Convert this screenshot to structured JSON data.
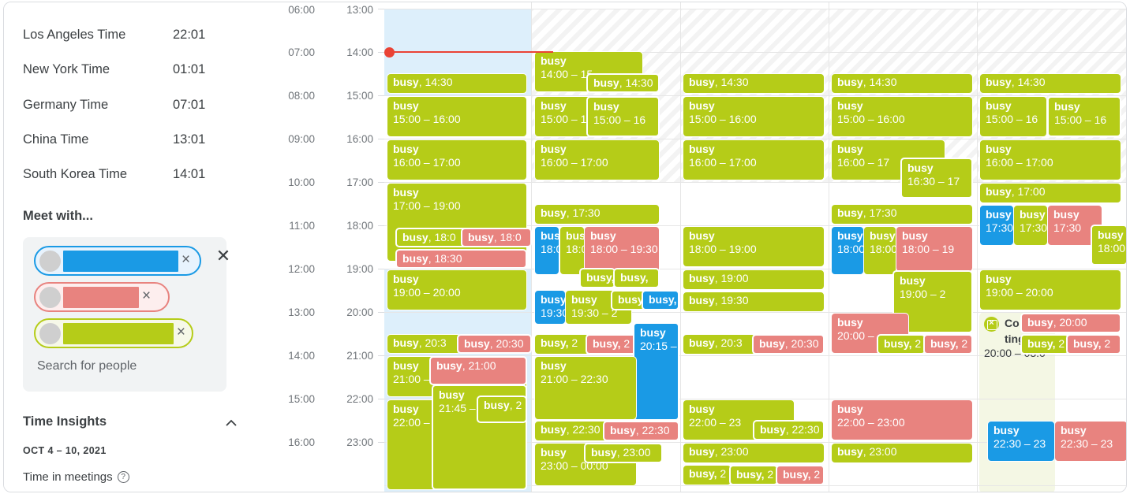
{
  "sidebar": {
    "timezones": [
      {
        "name": "Los Angeles Time",
        "time": "22:01",
        "icon": "moon-icon"
      },
      {
        "name": "New York Time",
        "time": "01:01",
        "icon": "moon-icon"
      },
      {
        "name": "Germany Time",
        "time": "07:01",
        "icon": "sun-icon"
      },
      {
        "name": "China Time",
        "time": "13:01",
        "icon": "sun-icon"
      },
      {
        "name": "South Korea Time",
        "time": "14:01",
        "icon": "sun-icon"
      }
    ],
    "meet_with": {
      "title": "Meet with...",
      "people": [
        {
          "color": "#1a9ae5",
          "remove_label": "×"
        },
        {
          "color": "#e8837f",
          "remove_label": "×"
        },
        {
          "color": "#b5cc18",
          "remove_label": "×"
        }
      ],
      "close_label": "✕",
      "search_placeholder": "Search for people"
    },
    "time_insights": {
      "title": "Time Insights",
      "collapse_icon": "chevron-up-icon",
      "date_range": "OCT 4 – 10, 2021",
      "metric_label": "Time in meetings",
      "help_icon": "question-mark-icon"
    }
  },
  "calendar": {
    "gutter_left": [
      "06:00",
      "07:00",
      "08:00",
      "09:00",
      "10:00",
      "11:00",
      "12:00",
      "13:00",
      "14:00",
      "15:00",
      "16:00"
    ],
    "gutter_right": [
      "13:00",
      "14:00",
      "15:00",
      "16:00",
      "17:00",
      "18:00",
      "19:00",
      "20:00",
      "21:00",
      "22:00",
      "23:00"
    ],
    "now_indicator": {
      "time": "14:00",
      "color": "#ea4335"
    },
    "colors": {
      "olive": "#b5cc18",
      "red": "#e8837f",
      "blue": "#1a9ae5",
      "hatch": "#f3f3f3",
      "selection": "#ddeffb"
    },
    "columns": [
      {
        "index": 0,
        "events": [
          {
            "title": "busy",
            "time": "14:30",
            "color": "olive",
            "start": "14:30",
            "end": "15:00",
            "lines": 1
          },
          {
            "title": "busy",
            "time": "15:00 – 16:00",
            "color": "olive",
            "start": "15:00",
            "end": "16:00",
            "lines": 2
          },
          {
            "title": "busy",
            "time": "16:00 – 17:00",
            "color": "olive",
            "start": "16:00",
            "end": "17:00",
            "lines": 2
          },
          {
            "title": "busy",
            "time": "17:00 – 19:00",
            "color": "olive",
            "start": "17:00",
            "end": "19:00",
            "lines": 2
          },
          {
            "title": "busy",
            "time": "18:0",
            "color": "olive",
            "start": "18:00",
            "end": "18:30",
            "lines": 1
          },
          {
            "title": "busy",
            "time": "18:0",
            "color": "red",
            "start": "18:00",
            "end": "18:30",
            "lines": 1
          },
          {
            "title": "busy",
            "time": "18:30",
            "color": "red",
            "start": "18:30",
            "end": "19:00",
            "lines": 1
          },
          {
            "title": "busy",
            "time": "19:00 – 20:00",
            "color": "olive",
            "start": "19:00",
            "end": "20:00",
            "lines": 2
          },
          {
            "title": "busy",
            "time": "20:3",
            "color": "olive",
            "start": "20:30",
            "end": "21:00",
            "lines": 1
          },
          {
            "title": "busy",
            "time": "20:30",
            "color": "red",
            "start": "20:30",
            "end": "21:00",
            "lines": 1
          },
          {
            "title": "busy",
            "time": "21:00 –",
            "color": "olive",
            "start": "21:00",
            "end": "22:00",
            "lines": 2
          },
          {
            "title": "busy",
            "time": "21:00",
            "color": "red",
            "start": "21:00",
            "end": "21:45",
            "lines": 1
          },
          {
            "title": "busy",
            "time": "22:00 –",
            "color": "olive",
            "start": "22:00",
            "end": "23:45",
            "lines": 2
          },
          {
            "title": "busy",
            "time": "21:45 –",
            "color": "olive",
            "start": "21:45",
            "end": "23:45",
            "lines": 2
          },
          {
            "title": "busy",
            "time": "2",
            "color": "olive",
            "start": "22:15",
            "end": "23:00",
            "lines": 1
          }
        ]
      },
      {
        "index": 1,
        "events": [
          {
            "title": "busy",
            "time": "14:00 – 15",
            "color": "olive",
            "start": "14:00",
            "end": "15:00",
            "lines": 2
          },
          {
            "title": "busy",
            "time": "14:30",
            "color": "olive",
            "start": "14:30",
            "end": "15:00",
            "lines": 1
          },
          {
            "title": "busy",
            "time": "15:00 – 16",
            "color": "olive",
            "start": "15:00",
            "end": "16:00",
            "lines": 2
          },
          {
            "title": "busy",
            "time": "15:00 – 16",
            "color": "olive",
            "start": "15:00",
            "end": "16:00",
            "lines": 2
          },
          {
            "title": "busy",
            "time": "16:00 – 17:00",
            "color": "olive",
            "start": "16:00",
            "end": "17:00",
            "lines": 2
          },
          {
            "title": "busy",
            "time": "17:30",
            "color": "olive",
            "start": "17:30",
            "end": "18:00",
            "lines": 1
          },
          {
            "title": "busy",
            "time": "18:0",
            "color": "blue",
            "start": "18:00",
            "end": "19:00",
            "lines": 2
          },
          {
            "title": "busy",
            "time": "18:0",
            "color": "olive",
            "start": "18:00",
            "end": "19:00",
            "lines": 2
          },
          {
            "title": "busy",
            "time": "18:00 – 19:30",
            "color": "red",
            "start": "18:00",
            "end": "19:30",
            "lines": 2
          },
          {
            "title": "busy,",
            "time": "",
            "color": "olive",
            "start": "18:45",
            "end": "19:15",
            "lines": 1
          },
          {
            "title": "busy,",
            "time": "",
            "color": "olive",
            "start": "18:45",
            "end": "19:15",
            "lines": 1
          },
          {
            "title": "busy",
            "time": "19:30",
            "color": "blue",
            "start": "19:30",
            "end": "20:15",
            "lines": 2
          },
          {
            "title": "busy",
            "time": "19:30 – 2",
            "color": "olive",
            "start": "19:30",
            "end": "20:15",
            "lines": 2
          },
          {
            "title": "busy",
            "time": "",
            "color": "olive",
            "start": "19:30",
            "end": "20:00",
            "lines": 1
          },
          {
            "title": "busy,",
            "time": "",
            "color": "blue",
            "start": "19:30",
            "end": "20:00",
            "lines": 1
          },
          {
            "title": "busy,",
            "time": "2",
            "color": "olive",
            "start": "20:30",
            "end": "21:00",
            "lines": 1
          },
          {
            "title": "busy,",
            "time": "2",
            "color": "red",
            "start": "20:30",
            "end": "21:00",
            "lines": 1
          },
          {
            "title": "busy",
            "time": "20:15 –",
            "color": "blue",
            "start": "20:15",
            "end": "22:00",
            "lines": 2
          },
          {
            "title": "busy",
            "time": "21:00 – 22:30",
            "color": "olive",
            "start": "21:00",
            "end": "22:30",
            "lines": 2
          },
          {
            "title": "busy",
            "time": "22:30",
            "color": "olive",
            "start": "22:30",
            "end": "23:00",
            "lines": 1
          },
          {
            "title": "busy",
            "time": "22:30",
            "color": "red",
            "start": "22:30",
            "end": "23:00",
            "lines": 1
          },
          {
            "title": "busy",
            "time": "23:00 – 00:00",
            "color": "olive",
            "start": "23:00",
            "end": "24:00",
            "lines": 2
          },
          {
            "title": "busy",
            "time": "23:00",
            "color": "olive",
            "start": "23:00",
            "end": "23:30",
            "lines": 1
          }
        ]
      },
      {
        "index": 2,
        "events": [
          {
            "title": "busy",
            "time": "14:30",
            "color": "olive",
            "start": "14:30",
            "end": "15:00",
            "lines": 1
          },
          {
            "title": "busy",
            "time": "15:00 – 16:00",
            "color": "olive",
            "start": "15:00",
            "end": "16:00",
            "lines": 2
          },
          {
            "title": "busy",
            "time": "16:00 – 17:00",
            "color": "olive",
            "start": "16:00",
            "end": "17:00",
            "lines": 2
          },
          {
            "title": "busy",
            "time": "18:00 – 19:00",
            "color": "olive",
            "start": "18:00",
            "end": "19:00",
            "lines": 2
          },
          {
            "title": "busy",
            "time": "19:00",
            "color": "olive",
            "start": "19:00",
            "end": "19:30",
            "lines": 1
          },
          {
            "title": "busy",
            "time": "19:30",
            "color": "olive",
            "start": "19:30",
            "end": "20:00",
            "lines": 1
          },
          {
            "title": "busy",
            "time": "20:3",
            "color": "olive",
            "start": "20:30",
            "end": "21:00",
            "lines": 1
          },
          {
            "title": "busy",
            "time": "20:30",
            "color": "red",
            "start": "20:30",
            "end": "21:00",
            "lines": 1
          },
          {
            "title": "busy",
            "time": "22:00 – 23",
            "color": "olive",
            "start": "22:00",
            "end": "23:00",
            "lines": 2
          },
          {
            "title": "busy",
            "time": "22:30",
            "color": "olive",
            "start": "22:30",
            "end": "23:00",
            "lines": 1
          },
          {
            "title": "busy",
            "time": "23:00",
            "color": "olive",
            "start": "23:00",
            "end": "23:30",
            "lines": 1
          },
          {
            "title": "busy,",
            "time": "2",
            "color": "olive",
            "start": "23:30",
            "end": "24:00",
            "lines": 1
          },
          {
            "title": "busy,",
            "time": "2",
            "color": "olive",
            "start": "23:30",
            "end": "24:00",
            "lines": 1
          },
          {
            "title": "busy,",
            "time": "2",
            "color": "red",
            "start": "23:30",
            "end": "24:00",
            "lines": 1
          }
        ]
      },
      {
        "index": 3,
        "events": [
          {
            "title": "busy",
            "time": "14:30",
            "color": "olive",
            "start": "14:30",
            "end": "15:00",
            "lines": 1
          },
          {
            "title": "busy",
            "time": "15:00 – 16:00",
            "color": "olive",
            "start": "15:00",
            "end": "16:00",
            "lines": 2
          },
          {
            "title": "busy",
            "time": "16:00 – 17",
            "color": "olive",
            "start": "16:00",
            "end": "17:00",
            "lines": 2
          },
          {
            "title": "busy",
            "time": "16:30 – 17",
            "color": "olive",
            "start": "16:30",
            "end": "17:30",
            "lines": 2
          },
          {
            "title": "busy",
            "time": "17:30",
            "color": "olive",
            "start": "17:30",
            "end": "18:00",
            "lines": 1
          },
          {
            "title": "busy",
            "time": "18:00",
            "color": "blue",
            "start": "18:00",
            "end": "19:00",
            "lines": 2
          },
          {
            "title": "busy",
            "time": "18:00",
            "color": "olive",
            "start": "18:00",
            "end": "19:00",
            "lines": 2
          },
          {
            "title": "busy",
            "time": "18:00 – 19",
            "color": "red",
            "start": "18:00",
            "end": "19:00",
            "lines": 2
          },
          {
            "title": "busy",
            "time": "19:00 – 2",
            "color": "olive",
            "start": "19:00",
            "end": "20:00",
            "lines": 2
          },
          {
            "title": "busy",
            "time": "20:00 –",
            "color": "red",
            "start": "20:00",
            "end": "21:00",
            "lines": 2
          },
          {
            "title": "busy,",
            "time": "2",
            "color": "olive",
            "start": "20:30",
            "end": "21:00",
            "lines": 1
          },
          {
            "title": "busy,",
            "time": "2",
            "color": "red",
            "start": "20:30",
            "end": "21:00",
            "lines": 1
          },
          {
            "title": "busy",
            "time": "22:00 – 23:00",
            "color": "red",
            "start": "22:00",
            "end": "23:00",
            "lines": 2
          },
          {
            "title": "busy",
            "time": "23:00",
            "color": "olive",
            "start": "23:00",
            "end": "23:30",
            "lines": 1
          }
        ]
      },
      {
        "index": 4,
        "events": [
          {
            "title": "busy",
            "time": "14:30",
            "color": "olive",
            "start": "14:30",
            "end": "15:00",
            "lines": 1
          },
          {
            "title": "busy",
            "time": "15:00 – 16",
            "color": "olive",
            "start": "15:00",
            "end": "16:00",
            "lines": 2
          },
          {
            "title": "busy",
            "time": "15:00 – 16",
            "color": "olive",
            "start": "15:00",
            "end": "16:00",
            "lines": 2
          },
          {
            "title": "busy",
            "time": "16:00 – 17:00",
            "color": "olive",
            "start": "16:00",
            "end": "17:00",
            "lines": 2
          },
          {
            "title": "busy",
            "time": "17:00",
            "color": "olive",
            "start": "17:00",
            "end": "17:30",
            "lines": 1
          },
          {
            "title": "busy",
            "time": "17:30",
            "color": "blue",
            "start": "17:30",
            "end": "18:00",
            "lines": 2
          },
          {
            "title": "busy",
            "time": "17:30",
            "color": "olive",
            "start": "17:30",
            "end": "18:00",
            "lines": 2
          },
          {
            "title": "busy",
            "time": "17:30",
            "color": "red",
            "start": "17:30",
            "end": "18:00",
            "lines": 2
          },
          {
            "title": "busy",
            "time": "18:00",
            "color": "olive",
            "start": "18:00",
            "end": "18:45",
            "lines": 2
          },
          {
            "title": "busy",
            "time": "19:00 – 20:00",
            "color": "olive",
            "start": "19:00",
            "end": "20:00",
            "lines": 2
          },
          {
            "title": "busy",
            "time": "20:00",
            "color": "red",
            "start": "20:00",
            "end": "20:30",
            "lines": 1
          },
          {
            "title": "busy,",
            "time": "2",
            "color": "olive",
            "start": "20:30",
            "end": "21:00",
            "lines": 1
          },
          {
            "title": "busy,",
            "time": "2",
            "color": "red",
            "start": "20:30",
            "end": "21:00",
            "lines": 1
          },
          {
            "title": "busy",
            "time": "22:30 – 23",
            "color": "blue",
            "start": "22:30",
            "end": "23:30",
            "lines": 2
          },
          {
            "title": "busy",
            "time": "22:30 – 23",
            "color": "red",
            "start": "22:30",
            "end": "23:30",
            "lines": 2
          }
        ],
        "long_event": {
          "title_line1": "Co",
          "title_line2": "ting",
          "time": "20:00 – 03:0",
          "icon": "declined-event-icon"
        }
      }
    ]
  }
}
